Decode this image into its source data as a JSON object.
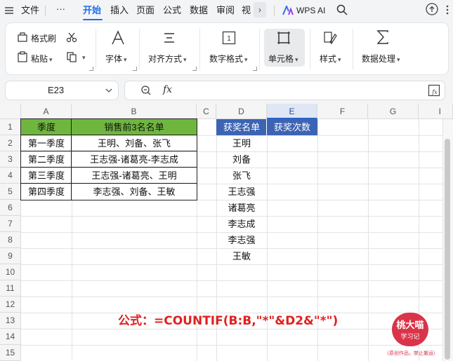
{
  "menu": {
    "file": "文件",
    "more": "···",
    "tabs": [
      "开始",
      "插入",
      "页面",
      "公式",
      "数据",
      "审阅",
      "视"
    ],
    "chevron": "›",
    "wps_ai": "WPS AI"
  },
  "ribbon": {
    "format_painter": "格式刷",
    "paste": "粘贴",
    "font": "字体",
    "align": "对齐方式",
    "number_format": "数字格式",
    "cell": "单元格",
    "style": "样式",
    "data_proc": "数据处理"
  },
  "formula_bar": {
    "name_box": "E23",
    "fx": "fx",
    "value": ""
  },
  "columns": [
    "A",
    "B",
    "C",
    "D",
    "E",
    "F",
    "G",
    "I"
  ],
  "rows": [
    "1",
    "2",
    "3",
    "4",
    "5",
    "6",
    "7",
    "8",
    "9",
    "10",
    "11",
    "12",
    "13",
    "14",
    "15"
  ],
  "table1": {
    "header": [
      "季度",
      "销售前3名名单"
    ],
    "rows": [
      [
        "第一季度",
        "王明、刘备、张飞"
      ],
      [
        "第二季度",
        "王志强-诸葛亮-李志成"
      ],
      [
        "第三季度",
        "王志强-诸葛亮、王明"
      ],
      [
        "第四季度",
        "李志强、刘备、王敏"
      ]
    ]
  },
  "table2": {
    "header": [
      "获奖名单",
      "获奖次数"
    ],
    "names": [
      "王明",
      "刘备",
      "张飞",
      "王志强",
      "诸葛亮",
      "李志成",
      "李志强",
      "王敏"
    ]
  },
  "formula_note": "公式：=COUNTIF(B:B,\"*\"&D2&\"*\")",
  "watermark": {
    "name": "桃大喵",
    "sub": "学习记",
    "caption": "（原创作品，禁止搬运）"
  },
  "colors": {
    "accent": "#1f6feb",
    "header_green": "#6fb63f",
    "header_blue": "#3d64b3",
    "formula_red": "#e02020"
  }
}
